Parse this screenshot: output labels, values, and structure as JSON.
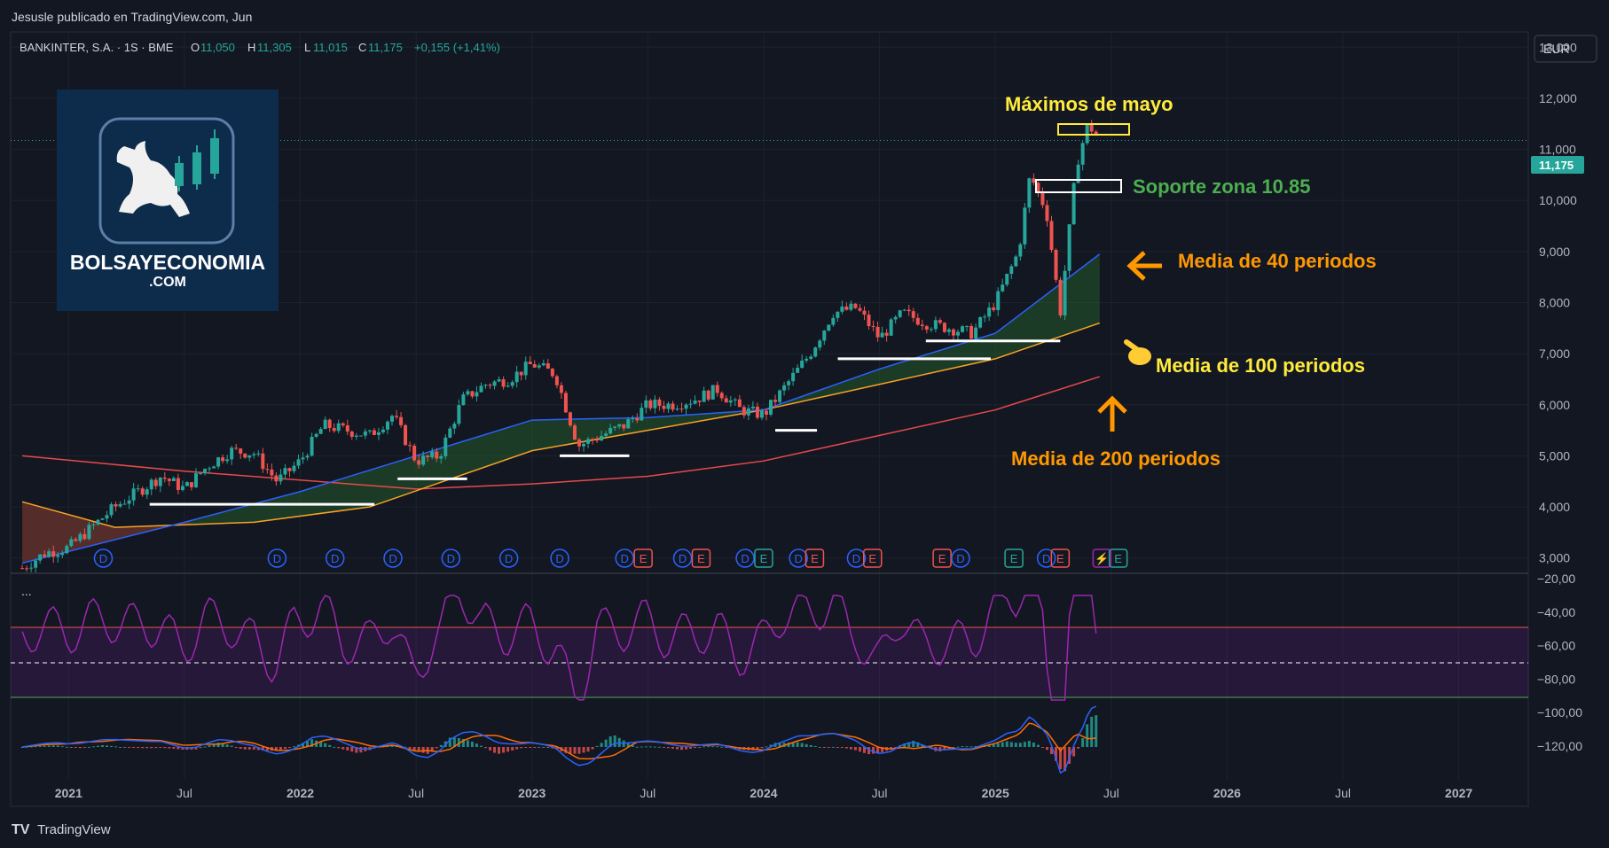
{
  "header": {
    "publish_text": "Jesusle publicado en TradingView.com, Jun"
  },
  "symbol": {
    "name": "BANKINTER, S.A. · 1S · BME",
    "o_label": "O",
    "o": "11,050",
    "h_label": "H",
    "h": "11,305",
    "l_label": "L",
    "l": "11,015",
    "c_label": "C",
    "c": "11,175",
    "change": "+0,155 (+1,41%)"
  },
  "currency_button": "EUR",
  "price_tag": "11,175",
  "logo": {
    "line1": "BOLSAYECONOMIA",
    "line2": ".COM"
  },
  "annotations": {
    "maximos": "Máximos de mayo",
    "soporte": "Soporte zona 10.85",
    "media40": "Media de 40 periodos",
    "media100": "Media de 100 periodos",
    "media200": "Media de 200 periodos"
  },
  "oscillator_label": "...",
  "footer": {
    "brand": "TradingView"
  },
  "colors": {
    "bg": "#131722",
    "up": "#26a69a",
    "down": "#ef5350",
    "ma40": "#2962ff",
    "ma100": "#f7a325",
    "ma200": "#e84a4a",
    "wpr": "#9c27b0",
    "macd": "#2962ff",
    "signal": "#ff6d00",
    "yellow": "#ffeb3b",
    "orange": "#ff9800",
    "green": "#4caf50"
  },
  "chart_data": [
    {
      "type": "candlestick",
      "title": "BANKINTER, S.A. · 1S · BME",
      "y_ticks": [
        "13,000",
        "12,000",
        "11,000",
        "10,000",
        "9,000",
        "8,000",
        "7,000",
        "6,000",
        "5,000",
        "4,000",
        "3,000"
      ],
      "x_ticks": [
        "2021",
        "Jul",
        "2022",
        "Jul",
        "2023",
        "Jul",
        "2024",
        "Jul",
        "2025",
        "Jul",
        "2026",
        "Jul",
        "2027"
      ],
      "ylim": [
        2.7,
        13.3
      ],
      "x_unit": "years",
      "xlim": [
        2020.75,
        2027.3
      ],
      "close": [
        {
          "x": 2020.8,
          "y": 2.8
        },
        {
          "x": 2020.9,
          "y": 3.1
        },
        {
          "x": 2021.0,
          "y": 3.2
        },
        {
          "x": 2021.1,
          "y": 3.6
        },
        {
          "x": 2021.2,
          "y": 4.0
        },
        {
          "x": 2021.3,
          "y": 4.3
        },
        {
          "x": 2021.4,
          "y": 4.6
        },
        {
          "x": 2021.5,
          "y": 4.35
        },
        {
          "x": 2021.6,
          "y": 4.8
        },
        {
          "x": 2021.7,
          "y": 5.1
        },
        {
          "x": 2021.8,
          "y": 5.05
        },
        {
          "x": 2021.9,
          "y": 4.5
        },
        {
          "x": 2022.0,
          "y": 4.9
        },
        {
          "x": 2022.1,
          "y": 5.6
        },
        {
          "x": 2022.2,
          "y": 5.5
        },
        {
          "x": 2022.3,
          "y": 5.4
        },
        {
          "x": 2022.4,
          "y": 5.8
        },
        {
          "x": 2022.5,
          "y": 4.9
        },
        {
          "x": 2022.6,
          "y": 5.0
        },
        {
          "x": 2022.7,
          "y": 6.1
        },
        {
          "x": 2022.8,
          "y": 6.4
        },
        {
          "x": 2022.9,
          "y": 6.5
        },
        {
          "x": 2023.0,
          "y": 6.8
        },
        {
          "x": 2023.1,
          "y": 6.6
        },
        {
          "x": 2023.2,
          "y": 5.2
        },
        {
          "x": 2023.3,
          "y": 5.4
        },
        {
          "x": 2023.4,
          "y": 5.6
        },
        {
          "x": 2023.5,
          "y": 6.0
        },
        {
          "x": 2023.6,
          "y": 6.0
        },
        {
          "x": 2023.7,
          "y": 6.1
        },
        {
          "x": 2023.8,
          "y": 6.3
        },
        {
          "x": 2023.9,
          "y": 5.9
        },
        {
          "x": 2024.0,
          "y": 5.8
        },
        {
          "x": 2024.1,
          "y": 6.4
        },
        {
          "x": 2024.2,
          "y": 7.0
        },
        {
          "x": 2024.3,
          "y": 7.8
        },
        {
          "x": 2024.4,
          "y": 7.9
        },
        {
          "x": 2024.5,
          "y": 7.3
        },
        {
          "x": 2024.6,
          "y": 7.8
        },
        {
          "x": 2024.7,
          "y": 7.6
        },
        {
          "x": 2024.8,
          "y": 7.5
        },
        {
          "x": 2024.9,
          "y": 7.4
        },
        {
          "x": 2025.0,
          "y": 8.0
        },
        {
          "x": 2025.1,
          "y": 9.0
        },
        {
          "x": 2025.15,
          "y": 10.5
        },
        {
          "x": 2025.22,
          "y": 9.8
        },
        {
          "x": 2025.28,
          "y": 7.8
        },
        {
          "x": 2025.35,
          "y": 10.7
        },
        {
          "x": 2025.4,
          "y": 11.5
        },
        {
          "x": 2025.45,
          "y": 11.175
        }
      ],
      "ma40": [
        {
          "x": 2020.8,
          "y": 2.9
        },
        {
          "x": 2021.5,
          "y": 3.7
        },
        {
          "x": 2022.0,
          "y": 4.3
        },
        {
          "x": 2022.5,
          "y": 5.0
        },
        {
          "x": 2023.0,
          "y": 5.7
        },
        {
          "x": 2023.5,
          "y": 5.75
        },
        {
          "x": 2024.0,
          "y": 5.9
        },
        {
          "x": 2024.5,
          "y": 6.7
        },
        {
          "x": 2025.0,
          "y": 7.4
        },
        {
          "x": 2025.45,
          "y": 8.95
        }
      ],
      "ma100": [
        {
          "x": 2020.8,
          "y": 4.1
        },
        {
          "x": 2021.2,
          "y": 3.6
        },
        {
          "x": 2021.8,
          "y": 3.7
        },
        {
          "x": 2022.3,
          "y": 4.0
        },
        {
          "x": 2023.0,
          "y": 5.1
        },
        {
          "x": 2023.5,
          "y": 5.5
        },
        {
          "x": 2024.0,
          "y": 5.9
        },
        {
          "x": 2024.5,
          "y": 6.4
        },
        {
          "x": 2025.0,
          "y": 6.9
        },
        {
          "x": 2025.45,
          "y": 7.6
        }
      ],
      "ma200": [
        {
          "x": 2020.8,
          "y": 5.0
        },
        {
          "x": 2021.5,
          "y": 4.7
        },
        {
          "x": 2022.5,
          "y": 4.35
        },
        {
          "x": 2023.0,
          "y": 4.45
        },
        {
          "x": 2023.5,
          "y": 4.6
        },
        {
          "x": 2024.0,
          "y": 4.9
        },
        {
          "x": 2024.5,
          "y": 5.4
        },
        {
          "x": 2025.0,
          "y": 5.9
        },
        {
          "x": 2025.45,
          "y": 6.55
        }
      ],
      "support_lines": [
        {
          "x0": 2021.35,
          "x1": 2022.32,
          "y": 4.05
        },
        {
          "x0": 2022.42,
          "x1": 2022.72,
          "y": 4.55
        },
        {
          "x0": 2023.12,
          "x1": 2023.42,
          "y": 5.0
        },
        {
          "x0": 2024.05,
          "x1": 2024.23,
          "y": 5.5
        },
        {
          "x0": 2024.32,
          "x1": 2024.98,
          "y": 6.9
        },
        {
          "x0": 2024.7,
          "x1": 2025.28,
          "y": 7.25
        }
      ]
    },
    {
      "type": "line",
      "series": "oscillator",
      "y_ticks": [
        "−20,00",
        "−40,00",
        "−60,00",
        "−80,00",
        "−100,00",
        "−120,00"
      ]
    }
  ],
  "event_markers": [
    {
      "x": 2021.15,
      "label": "D"
    },
    {
      "x": 2021.9,
      "label": "D"
    },
    {
      "x": 2022.15,
      "label": "D"
    },
    {
      "x": 2022.4,
      "label": "D"
    },
    {
      "x": 2022.65,
      "label": "D"
    },
    {
      "x": 2022.9,
      "label": "D"
    },
    {
      "x": 2023.12,
      "label": "D"
    },
    {
      "x": 2023.4,
      "label": "D"
    },
    {
      "x": 2023.48,
      "label": "E"
    },
    {
      "x": 2023.65,
      "label": "D"
    },
    {
      "x": 2023.73,
      "label": "E"
    },
    {
      "x": 2023.92,
      "label": "D"
    },
    {
      "x": 2024.0,
      "label": "E"
    },
    {
      "x": 2024.15,
      "label": "D"
    },
    {
      "x": 2024.22,
      "label": "E"
    },
    {
      "x": 2024.4,
      "label": "D"
    },
    {
      "x": 2024.47,
      "label": "E"
    },
    {
      "x": 2024.77,
      "label": "E"
    },
    {
      "x": 2024.85,
      "label": "D"
    },
    {
      "x": 2025.08,
      "label": "E"
    },
    {
      "x": 2025.22,
      "label": "D"
    },
    {
      "x": 2025.28,
      "label": "E"
    },
    {
      "x": 2025.46,
      "label": "⚡"
    },
    {
      "x": 2025.53,
      "label": "E"
    }
  ]
}
